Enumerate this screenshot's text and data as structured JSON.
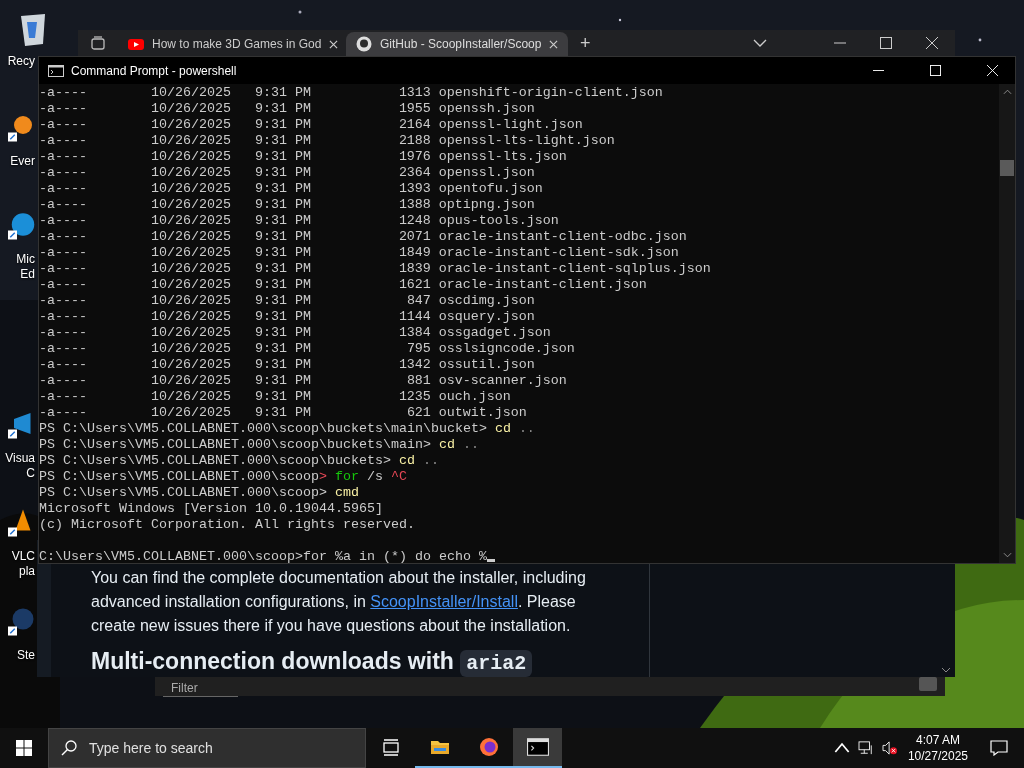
{
  "desktop_icons": [
    {
      "label_lines": [
        "Recy"
      ],
      "kind": "recycle"
    },
    {
      "label_lines": [
        "Ever"
      ],
      "kind": "everything"
    },
    {
      "label_lines": [
        "Mic",
        "Ed"
      ],
      "kind": "edge"
    },
    {
      "label_lines": [
        "Visua",
        "C"
      ],
      "kind": "vscode"
    },
    {
      "label_lines": [
        "VLC",
        "pla"
      ],
      "kind": "vlc"
    },
    {
      "label_lines": [
        "Ste"
      ],
      "kind": "steam"
    }
  ],
  "browser": {
    "tabs": [
      {
        "title": "How to make 3D Games in God",
        "kind": "youtube",
        "selected": false
      },
      {
        "title": "GitHub - ScoopInstaller/Scoop",
        "kind": "github",
        "selected": true
      }
    ],
    "new_tab": "+"
  },
  "docs": {
    "paragraph": "You can find the complete documentation about the installer, including advanced installation configurations, in ",
    "link": "ScoopInstaller/Install",
    "paragraph_end": ". Please create new issues there if you have questions about the installation.",
    "heading": "Multi-connection downloads with",
    "heading_code": "aria2"
  },
  "filter_window": {
    "placeholder": "Filter"
  },
  "terminal": {
    "title": "Command Prompt - powershell",
    "listing": [
      {
        "mode": "-a----",
        "date": "10/26/2025",
        "time": "9:31 PM",
        "length": "1313",
        "name": "openshift-origin-client.json"
      },
      {
        "mode": "-a----",
        "date": "10/26/2025",
        "time": "9:31 PM",
        "length": "1955",
        "name": "openssh.json"
      },
      {
        "mode": "-a----",
        "date": "10/26/2025",
        "time": "9:31 PM",
        "length": "2164",
        "name": "openssl-light.json"
      },
      {
        "mode": "-a----",
        "date": "10/26/2025",
        "time": "9:31 PM",
        "length": "2188",
        "name": "openssl-lts-light.json"
      },
      {
        "mode": "-a----",
        "date": "10/26/2025",
        "time": "9:31 PM",
        "length": "1976",
        "name": "openssl-lts.json"
      },
      {
        "mode": "-a----",
        "date": "10/26/2025",
        "time": "9:31 PM",
        "length": "2364",
        "name": "openssl.json"
      },
      {
        "mode": "-a----",
        "date": "10/26/2025",
        "time": "9:31 PM",
        "length": "1393",
        "name": "opentofu.json"
      },
      {
        "mode": "-a----",
        "date": "10/26/2025",
        "time": "9:31 PM",
        "length": "1388",
        "name": "optipng.json"
      },
      {
        "mode": "-a----",
        "date": "10/26/2025",
        "time": "9:31 PM",
        "length": "1248",
        "name": "opus-tools.json"
      },
      {
        "mode": "-a----",
        "date": "10/26/2025",
        "time": "9:31 PM",
        "length": "2071",
        "name": "oracle-instant-client-odbc.json"
      },
      {
        "mode": "-a----",
        "date": "10/26/2025",
        "time": "9:31 PM",
        "length": "1849",
        "name": "oracle-instant-client-sdk.json"
      },
      {
        "mode": "-a----",
        "date": "10/26/2025",
        "time": "9:31 PM",
        "length": "1839",
        "name": "oracle-instant-client-sqlplus.json"
      },
      {
        "mode": "-a----",
        "date": "10/26/2025",
        "time": "9:31 PM",
        "length": "1621",
        "name": "oracle-instant-client.json"
      },
      {
        "mode": "-a----",
        "date": "10/26/2025",
        "time": "9:31 PM",
        "length": "847",
        "name": "oscdimg.json"
      },
      {
        "mode": "-a----",
        "date": "10/26/2025",
        "time": "9:31 PM",
        "length": "1144",
        "name": "osquery.json"
      },
      {
        "mode": "-a----",
        "date": "10/26/2025",
        "time": "9:31 PM",
        "length": "1384",
        "name": "ossgadget.json"
      },
      {
        "mode": "-a----",
        "date": "10/26/2025",
        "time": "9:31 PM",
        "length": "795",
        "name": "osslsigncode.json"
      },
      {
        "mode": "-a----",
        "date": "10/26/2025",
        "time": "9:31 PM",
        "length": "1342",
        "name": "ossutil.json"
      },
      {
        "mode": "-a----",
        "date": "10/26/2025",
        "time": "9:31 PM",
        "length": "881",
        "name": "osv-scanner.json"
      },
      {
        "mode": "-a----",
        "date": "10/26/2025",
        "time": "9:31 PM",
        "length": "1235",
        "name": "ouch.json"
      },
      {
        "mode": "-a----",
        "date": "10/26/2025",
        "time": "9:31 PM",
        "length": "621",
        "name": "outwit.json"
      }
    ],
    "commands": [
      {
        "prompt": "PS C:\\Users\\VM5.COLLABNET.000\\scoop\\buckets\\main\\bucket",
        "marker": ">",
        "error": false,
        "parts": [
          {
            "text": "cd",
            "kind": "command"
          },
          {
            "text": "..",
            "kind": "argument"
          }
        ]
      },
      {
        "prompt": "PS C:\\Users\\VM5.COLLABNET.000\\scoop\\buckets\\main",
        "marker": ">",
        "error": false,
        "parts": [
          {
            "text": "cd",
            "kind": "command"
          },
          {
            "text": "..",
            "kind": "argument"
          }
        ]
      },
      {
        "prompt": "PS C:\\Users\\VM5.COLLABNET.000\\scoop\\buckets",
        "marker": ">",
        "error": false,
        "parts": [
          {
            "text": "cd",
            "kind": "command"
          },
          {
            "text": "..",
            "kind": "argument"
          }
        ]
      },
      {
        "prompt": "PS C:\\Users\\VM5.COLLABNET.000\\scoop",
        "marker": ">",
        "error": true,
        "parts": [
          {
            "text": "for",
            "kind": "keyword"
          },
          {
            "text": "/s",
            "kind": "parameter"
          },
          {
            "text": "^C",
            "kind": "interrupt"
          }
        ]
      },
      {
        "prompt": "PS C:\\Users\\VM5.COLLABNET.000\\scoop",
        "marker": ">",
        "error": false,
        "parts": [
          {
            "text": "cmd",
            "kind": "command"
          }
        ]
      }
    ],
    "output": [
      "Microsoft Windows [Version 10.0.19044.5965]",
      "(c) Microsoft Corporation. All rights reserved."
    ],
    "input_line": "C:\\Users\\VM5.COLLABNET.000\\scoop>for %a in (*) do echo %"
  },
  "taskbar": {
    "search_placeholder": "Type here to search",
    "apps": [
      {
        "kind": "taskview",
        "running": false,
        "selected": false
      },
      {
        "kind": "explorer",
        "running": true,
        "selected": false
      },
      {
        "kind": "firefox",
        "running": true,
        "selected": false
      },
      {
        "kind": "terminal",
        "running": true,
        "selected": true
      }
    ],
    "time": "4:07 AM",
    "date": "10/27/2025",
    "volume_muted": true
  }
}
